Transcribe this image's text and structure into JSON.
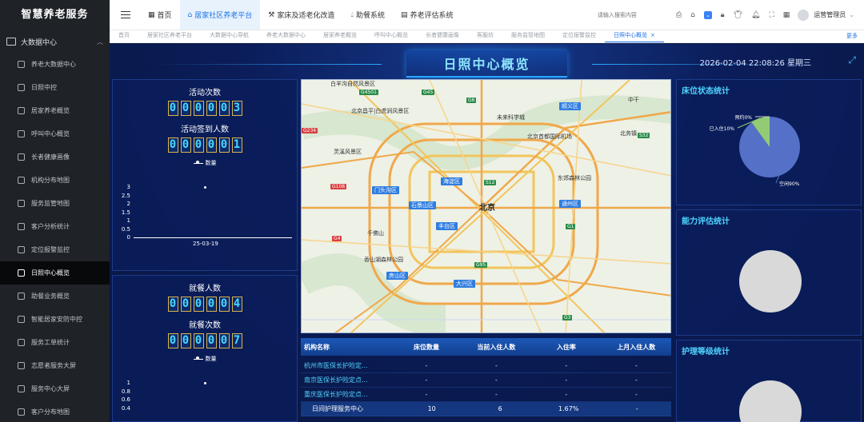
{
  "sidebar": {
    "logo": "智慧养老服务",
    "group": "大数据中心",
    "items": [
      {
        "label": "养老大数据中心"
      },
      {
        "label": "日照中控"
      },
      {
        "label": "居家养老概览"
      },
      {
        "label": "呼叫中心概览"
      },
      {
        "label": "长者健康画像"
      },
      {
        "label": "机构分布地图"
      },
      {
        "label": "服务监管地图"
      },
      {
        "label": "客户分析统计"
      },
      {
        "label": "定位报警监控"
      },
      {
        "label": "日照中心概览"
      },
      {
        "label": "助餐业务概览"
      },
      {
        "label": "智能居家安防中控"
      },
      {
        "label": "服务工单统计"
      },
      {
        "label": "志愿者服务大屏"
      },
      {
        "label": "服务中心大屏"
      },
      {
        "label": "客户分布地图"
      }
    ]
  },
  "header": {
    "nav": [
      {
        "label": "首页",
        "icon": "grid-icon"
      },
      {
        "label": "居家社区养老平台",
        "icon": "home-icon"
      },
      {
        "label": "家床及适老化改造",
        "icon": "hammer-icon"
      },
      {
        "label": "助餐系统",
        "icon": "drop-icon"
      },
      {
        "label": "养老评估系统",
        "icon": "document-icon"
      }
    ],
    "search_placeholder": "请输入搜索内容",
    "user_name": "运营管理员"
  },
  "tabs": {
    "items": [
      "首页",
      "居家社区养老平台",
      "大数据中心导航",
      "养老大数据中心",
      "居家养老概览",
      "呼叫中心概览",
      "长者健康画像",
      "客服坊",
      "服务监管地图",
      "定位报警监控",
      "日照中心概览"
    ],
    "more": "更多"
  },
  "dashboard": {
    "title": "日照中心概览",
    "datetime": "2026-02-04 22:08:26 星期三"
  },
  "activity": {
    "label1": "活动次数",
    "digits1": [
      "0",
      "0",
      "0",
      "0",
      "0",
      "3"
    ],
    "label2": "活动签到人数",
    "digits2": [
      "0",
      "0",
      "0",
      "0",
      "0",
      "1"
    ],
    "legend": "数量",
    "chart_data": {
      "type": "scatter",
      "x": [
        "25-03-19"
      ],
      "y": [
        3
      ],
      "legend": "数量",
      "ylim": [
        0,
        3
      ],
      "yticks": [
        "3",
        "2.5",
        "2",
        "1.5",
        "1",
        "0.5",
        "0"
      ]
    }
  },
  "meals": {
    "label1": "就餐人数",
    "digits1": [
      "0",
      "0",
      "0",
      "0",
      "0",
      "4"
    ],
    "label2": "就餐次数",
    "digits2": [
      "0",
      "0",
      "0",
      "0",
      "0",
      "7"
    ],
    "legend": "数量",
    "chart_data": {
      "type": "scatter",
      "x": [
        ""
      ],
      "y": [
        1
      ],
      "legend": "数量",
      "ylim": [
        0,
        1
      ],
      "yticks": [
        "1",
        "0.8",
        "0.6",
        "0.4"
      ]
    }
  },
  "map": {
    "labels": {
      "beijing": "北京",
      "changping": "北京昌平|白虎涧风景区",
      "shunyi": "顺义区",
      "airport": "北京首都国际机场",
      "haidian": "海淀区",
      "shijingshan": "石景山区",
      "mentougou": "门头沟区",
      "fengtai": "丰台区",
      "tongzhou": "通州区",
      "daxing": "大兴区",
      "fangshan": "房山区",
      "lingshan": "灵溪风景区",
      "xiaoyangfang": "白羊沟自然风景区",
      "qianfoshan": "千佛山",
      "xiangshan": "香山湖森林公园",
      "weilaikexuecheng": "未来科学城",
      "dongjiao": "东郊森林公园",
      "zhongcheng": "中干",
      "beishun": "北务镇"
    },
    "routes": [
      "G4501",
      "G45",
      "G6",
      "S12",
      "G1",
      "S32",
      "G234",
      "G108",
      "G4",
      "G95",
      "G3"
    ]
  },
  "table": {
    "headers": [
      "机构名称",
      "床位数量",
      "当前入住人数",
      "入住率",
      "上月入住人数"
    ],
    "rows": [
      [
        "杭州市医保长护险定...",
        "-",
        "-",
        "-",
        "-"
      ],
      [
        "南京医保长护险定点...",
        "-",
        "-",
        "-",
        "-"
      ],
      [
        "重庆医保长护险定点...",
        "-",
        "-",
        "-",
        "-"
      ],
      [
        "日间护理服务中心",
        "10",
        "6",
        "1.67%",
        "-"
      ]
    ]
  },
  "bed_status": {
    "title": "床位状态统计",
    "chart_data": {
      "type": "pie",
      "slices": [
        {
          "name": "空闲",
          "label": "空闲90%",
          "value": 90,
          "color": "#5471c7"
        },
        {
          "name": "已入住",
          "label": "已入住10%",
          "value": 10,
          "color": "#91cc75"
        },
        {
          "name": "预约",
          "label": "预约0%",
          "value": 0,
          "color": "#fac858"
        }
      ]
    }
  },
  "ability": {
    "title": "能力评估统计"
  },
  "care_level": {
    "title": "护理等级统计"
  }
}
